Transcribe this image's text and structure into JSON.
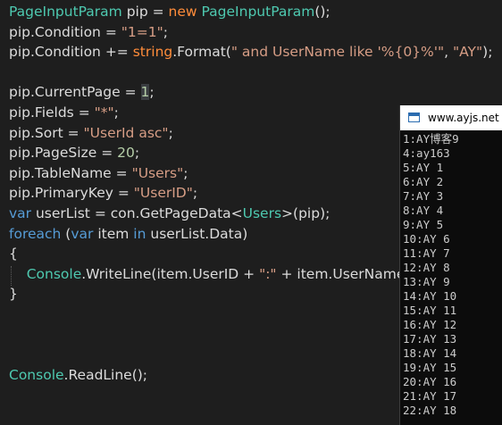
{
  "code_lines": [
    [
      [
        "type",
        "PageInputParam"
      ],
      [
        "op",
        " "
      ],
      [
        "ident",
        "pip"
      ],
      [
        "op",
        " = "
      ],
      [
        "new",
        "new"
      ],
      [
        "op",
        " "
      ],
      [
        "type",
        "PageInputParam"
      ],
      [
        "op",
        "();"
      ]
    ],
    [
      [
        "ident",
        "pip.Condition"
      ],
      [
        "op",
        " = "
      ],
      [
        "str",
        "\"1=1\""
      ],
      [
        "op",
        ";"
      ]
    ],
    [
      [
        "ident",
        "pip.Condition"
      ],
      [
        "op",
        " += "
      ],
      [
        "new",
        "string"
      ],
      [
        "ident",
        ".Format("
      ],
      [
        "str",
        "\" and UserName like '%{0}%'\""
      ],
      [
        "op",
        ", "
      ],
      [
        "str",
        "\"AY\""
      ],
      [
        "op",
        ");"
      ]
    ],
    [],
    [
      [
        "ident",
        "pip.CurrentPage"
      ],
      [
        "op",
        " = "
      ],
      [
        "num_hl",
        "1"
      ],
      [
        "op",
        ";"
      ]
    ],
    [
      [
        "ident",
        "pip.Fields"
      ],
      [
        "op",
        " = "
      ],
      [
        "str",
        "\"*\""
      ],
      [
        "op",
        ";"
      ]
    ],
    [
      [
        "ident",
        "pip.Sort"
      ],
      [
        "op",
        " = "
      ],
      [
        "str",
        "\"UserId asc\""
      ],
      [
        "op",
        ";"
      ]
    ],
    [
      [
        "ident",
        "pip.PageSize"
      ],
      [
        "op",
        " = "
      ],
      [
        "num",
        "20"
      ],
      [
        "op",
        ";"
      ]
    ],
    [
      [
        "ident",
        "pip.TableName"
      ],
      [
        "op",
        " = "
      ],
      [
        "str",
        "\"Users\""
      ],
      [
        "op",
        ";"
      ]
    ],
    [
      [
        "ident",
        "pip.PrimaryKey"
      ],
      [
        "op",
        " = "
      ],
      [
        "str",
        "\"UserID\""
      ],
      [
        "op",
        ";"
      ]
    ],
    [
      [
        "kw",
        "var"
      ],
      [
        "op",
        " "
      ],
      [
        "ident",
        "userList = con.GetPageData<"
      ],
      [
        "type",
        "Users"
      ],
      [
        "ident",
        ">(pip);"
      ]
    ],
    [
      [
        "kw",
        "foreach"
      ],
      [
        "op",
        " ("
      ],
      [
        "kw",
        "var"
      ],
      [
        "op",
        " "
      ],
      [
        "ident",
        "item"
      ],
      [
        "op",
        " "
      ],
      [
        "kw",
        "in"
      ],
      [
        "op",
        " "
      ],
      [
        "ident",
        "userList.Data)"
      ]
    ],
    [
      [
        "op",
        "{"
      ]
    ],
    [
      [
        "op",
        "    "
      ],
      [
        "type",
        "Console"
      ],
      [
        "ident",
        ".WriteLine(item.UserID + "
      ],
      [
        "str",
        "\":\""
      ],
      [
        "ident",
        " + item.UserName);"
      ]
    ],
    [
      [
        "op",
        "}"
      ]
    ],
    [],
    [],
    [],
    [
      [
        "type",
        "Console"
      ],
      [
        "ident",
        ".ReadLine();"
      ]
    ]
  ],
  "console": {
    "title": "www.ayjs.net",
    "lines": [
      "1:AY博客9",
      "4:ay163",
      "5:AY 1",
      "6:AY 2",
      "7:AY 3",
      "8:AY 4",
      "9:AY 5",
      "10:AY 6",
      "11:AY 7",
      "12:AY 8",
      "13:AY 9",
      "14:AY 10",
      "15:AY 11",
      "16:AY 12",
      "17:AY 13",
      "18:AY 14",
      "19:AY 15",
      "20:AY 16",
      "21:AY 17",
      "22:AY 18"
    ]
  },
  "colors": {
    "editor_bg": "#1e1e1e",
    "type": "#4ec9b0",
    "keyword": "#569cd6",
    "new_keyword": "#ff8c3a",
    "string": "#d69d85",
    "number": "#b5cea8",
    "console_bg": "#0c0c0c"
  }
}
